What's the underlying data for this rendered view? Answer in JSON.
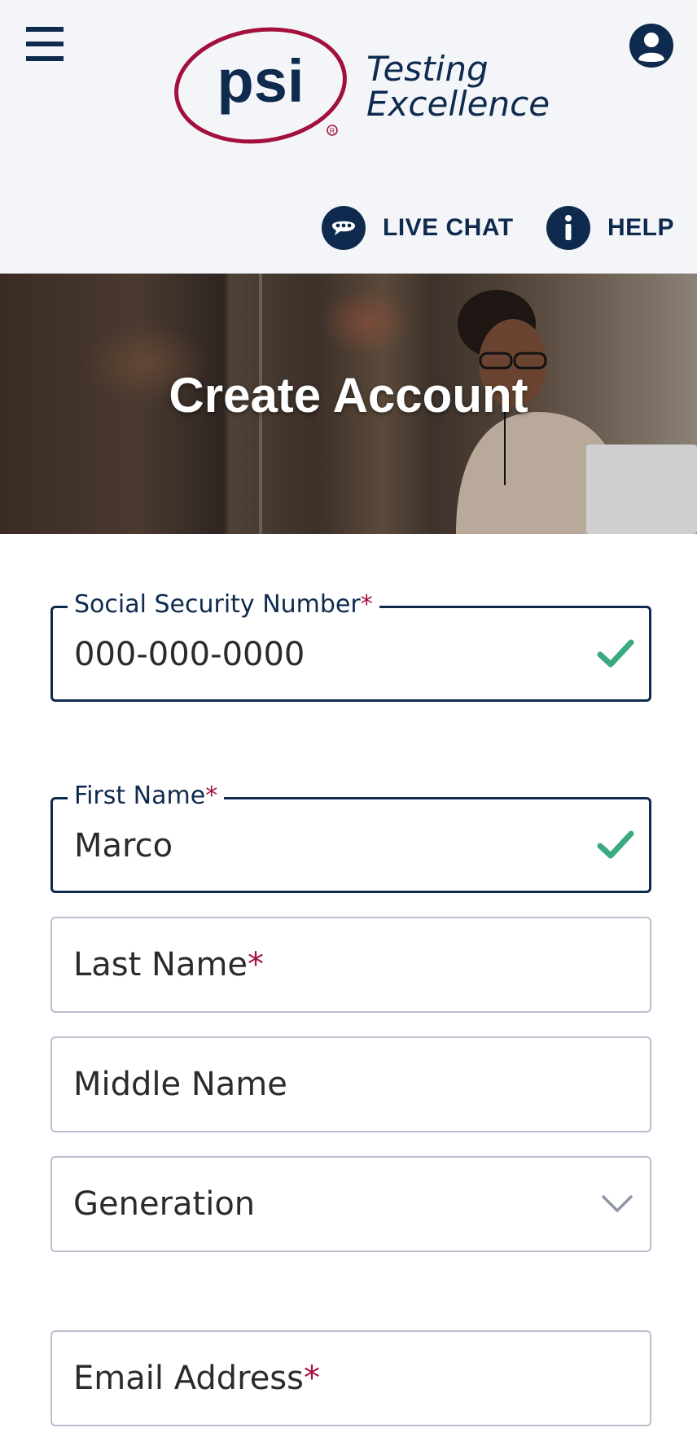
{
  "header": {
    "logo_brand": "psi",
    "logo_tagline_1": "Testing",
    "logo_tagline_2": "Excellence",
    "live_chat_label": "LIVE CHAT",
    "help_label": "HELP"
  },
  "hero": {
    "title": "Create Account"
  },
  "form": {
    "ssn": {
      "label": "Social Security Number",
      "required_mark": "*",
      "value": "000-000-0000",
      "valid": true
    },
    "first_name": {
      "label": "First Name",
      "required_mark": "*",
      "value": "Marco",
      "valid": true
    },
    "last_name": {
      "placeholder": "Last Name",
      "required_mark": "*"
    },
    "middle_name": {
      "placeholder": "Middle Name"
    },
    "generation": {
      "placeholder": "Generation"
    },
    "email": {
      "placeholder": "Email Address",
      "required_mark": "*"
    }
  },
  "colors": {
    "navy": "#0e2a4e",
    "brand_red": "#a4103d",
    "success_green": "#3aaa7f",
    "field_border": "#b9c1cf"
  },
  "icons": [
    "menu-icon",
    "user-account-icon",
    "chat-bubble-icon",
    "info-icon",
    "check-icon",
    "chevron-down-icon"
  ]
}
